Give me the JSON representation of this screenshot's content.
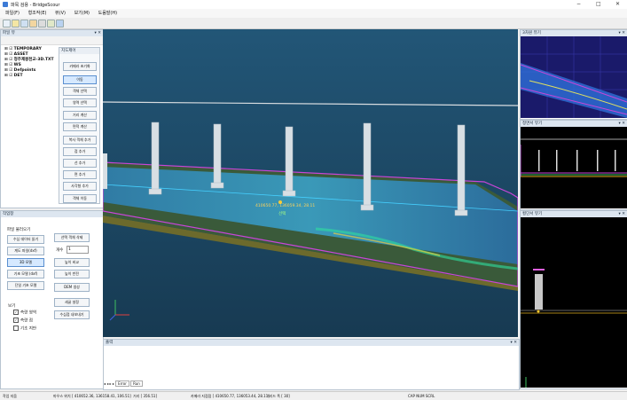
{
  "window": {
    "title": "파목 검용 - BridgeScour",
    "controls": [
      "−",
      "□",
      "✕"
    ]
  },
  "menu": [
    "파일(F)",
    "형조작(E)",
    "뷰(V)",
    "보기(M)",
    "도움말(H)"
  ],
  "file_panel": {
    "title": "파일 뷰",
    "tree": [
      "TEMPORARY",
      "ASSET",
      "청주제봉천교-3D.TXT",
      "WS",
      "Defpoints",
      "DET"
    ]
  },
  "tool_panel": {
    "title": "지도제어",
    "buttons": [
      "카메라 초기화",
      "이동",
      "객체 선택",
      "영역 선택",
      "거리 계산",
      "면적 계산",
      "복사 객체 추가",
      "점 추가",
      "선 추가",
      "면 추가",
      "사각형 추가",
      "객체 이동"
    ]
  },
  "work_panel": {
    "title": "작업창",
    "section": "파일 불러오기",
    "left_buttons": [
      "수심 데이터 읽기",
      "계도 파일(dxf)",
      "3D 모델",
      "기초 모델 (dxf)",
      "단일 기초 모델"
    ],
    "right_buttons": [
      "선택 객체 삭제",
      "높이 비교",
      "높이 반전",
      "DEM 생성",
      "세굴 설정",
      "수심점 내보내기"
    ],
    "count_label": "개수",
    "count_value": "1",
    "view_section": "보기",
    "checks": [
      {
        "label": "측량 영역",
        "checked": true
      },
      {
        "label": "측량 점",
        "checked": true
      },
      {
        "label": "기초 지반",
        "checked": false
      }
    ]
  },
  "viewport": {
    "coord_label": "410650.77, 136059.34, 28.11",
    "point_label": "선택"
  },
  "right_panels": [
    "3차원 뷰기",
    "정면서 뷰기",
    "횡단서 뷰기"
  ],
  "output_panel": {
    "title": "출력",
    "tabs": [
      "Error",
      "Run"
    ]
  },
  "status": {
    "left": "작업 지움",
    "mouse": "마우스 위치 [ 410652.36, 136158.41, 106.51]",
    "dist": "거리 [ 356.51]",
    "camera": "카메라 지점점 [ 410650.77, 136053.44, 28.11]",
    "scale": "그리드 폭 [ 30]",
    "caps": "CAP NUM SCRL"
  },
  "colors": {
    "viewport_bg": "#1f4a66",
    "accent": "#5a8fd0"
  }
}
